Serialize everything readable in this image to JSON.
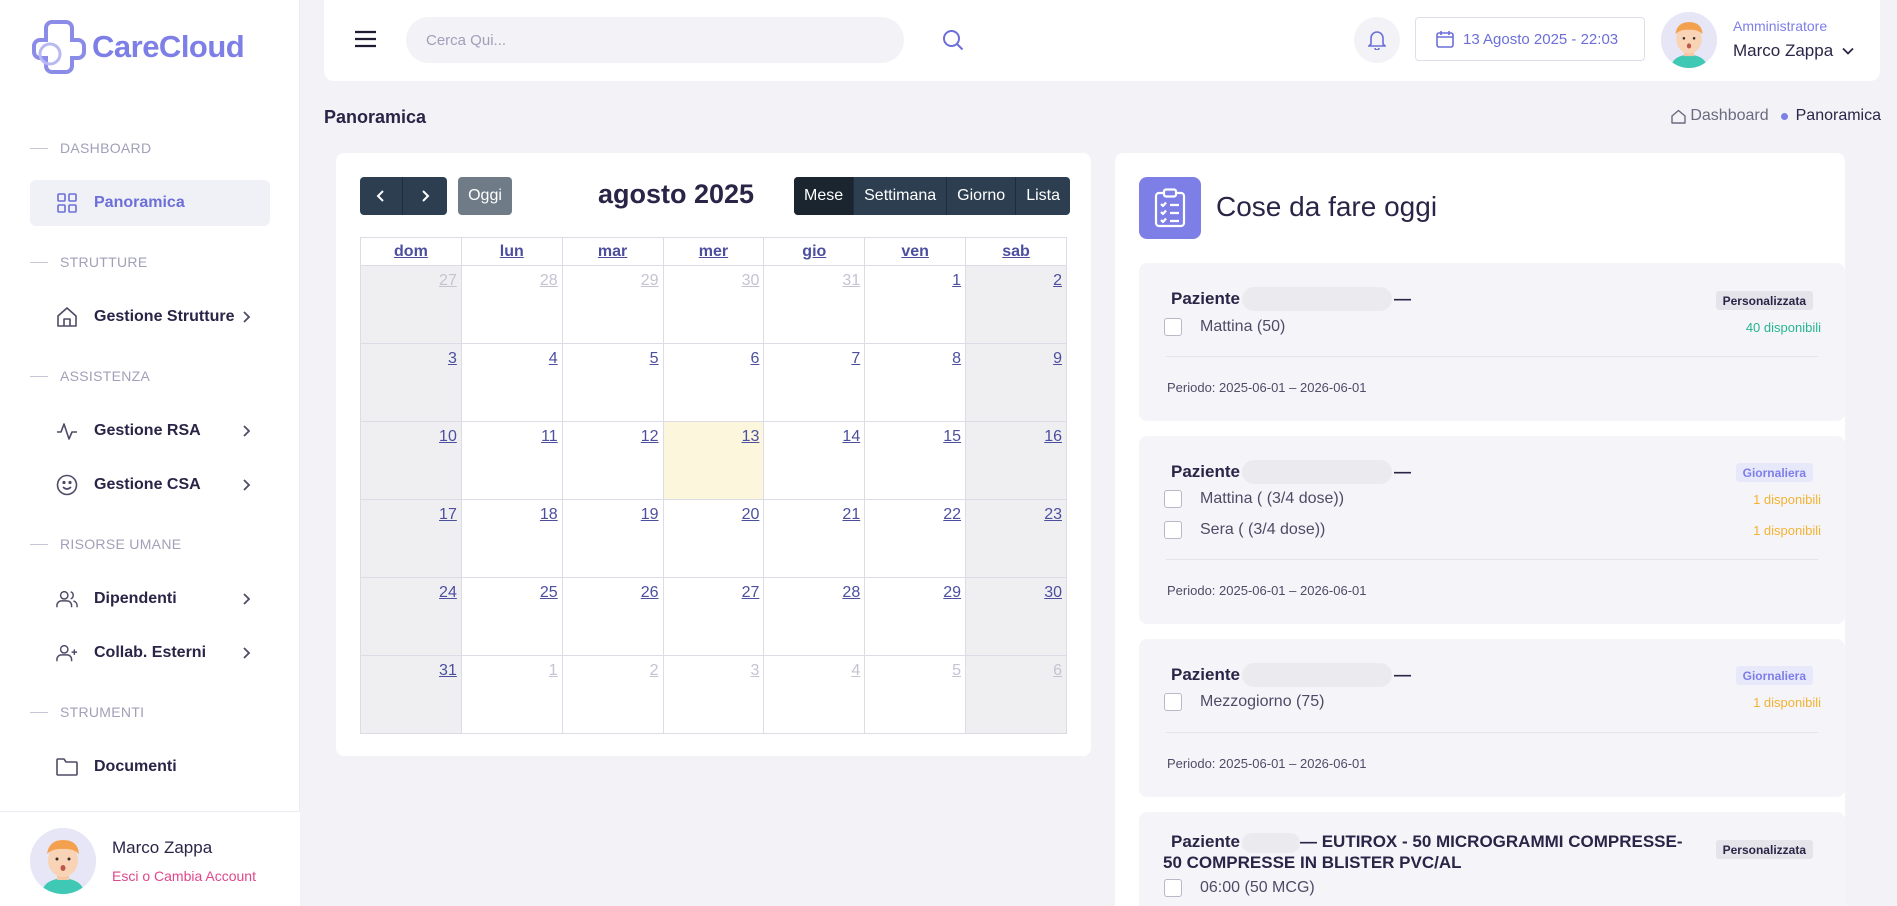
{
  "brand": {
    "name": "CareCloud",
    "color": "#7d7fe7"
  },
  "sidebar": {
    "sections": [
      {
        "label": "DASHBOARD"
      },
      {
        "label": "STRUTTURE"
      },
      {
        "label": "ASSISTENZA"
      },
      {
        "label": "RISORSE UMANE"
      },
      {
        "label": "STRUMENTI"
      }
    ],
    "items": [
      {
        "label": "Panoramica",
        "icon": "grid-icon",
        "active": true
      },
      {
        "label": "Gestione Strutture",
        "icon": "home-icon"
      },
      {
        "label": "Gestione RSA",
        "icon": "activity-icon"
      },
      {
        "label": "Gestione CSA",
        "icon": "smile-icon"
      },
      {
        "label": "Dipendenti",
        "icon": "users-icon"
      },
      {
        "label": "Collab. Esterni",
        "icon": "user-plus-icon"
      },
      {
        "label": "Documenti",
        "icon": "folder-icon"
      }
    ],
    "footer": {
      "name": "Marco Zappa",
      "action": "Esci o Cambia Account"
    }
  },
  "header": {
    "search_placeholder": "Cerca Qui...",
    "datetime": "13 Agosto 2025 - 22:03",
    "user_role": "Amministratore",
    "user_name": "Marco Zappa"
  },
  "page": {
    "title": "Panoramica",
    "breadcrumb": [
      "Dashboard",
      "Panoramica"
    ]
  },
  "calendar": {
    "today_label": "Oggi",
    "title": "agosto 2025",
    "views": [
      "Mese",
      "Settimana",
      "Giorno",
      "Lista"
    ],
    "active_view": "Mese",
    "weekdays": [
      "dom",
      "lun",
      "mar",
      "mer",
      "gio",
      "ven",
      "sab"
    ],
    "weeks": [
      [
        "27",
        "28",
        "29",
        "30",
        "31",
        "1",
        "2"
      ],
      [
        "3",
        "4",
        "5",
        "6",
        "7",
        "8",
        "9"
      ],
      [
        "10",
        "11",
        "12",
        "13",
        "14",
        "15",
        "16"
      ],
      [
        "17",
        "18",
        "19",
        "20",
        "21",
        "22",
        "23"
      ],
      [
        "24",
        "25",
        "26",
        "27",
        "28",
        "29",
        "30"
      ],
      [
        "31",
        "1",
        "2",
        "3",
        "4",
        "5",
        "6"
      ]
    ],
    "today": "13"
  },
  "todo": {
    "title": "Cose da fare oggi",
    "tasks": [
      {
        "label": "Paziente",
        "suffix": "—",
        "type": "Personalizzata",
        "doses": [
          {
            "label": "Mattina (50)",
            "available": "40 disponibili",
            "status": "ok"
          }
        ],
        "period": "Periodo: 2025-06-01 – 2026-06-01"
      },
      {
        "label": "Paziente",
        "suffix": "—",
        "type": "Giornaliera",
        "doses": [
          {
            "label": "Mattina ( (3/4 dose))",
            "available": "1 disponibili",
            "status": "warn"
          },
          {
            "label": "Sera ( (3/4 dose))",
            "available": "1 disponibili",
            "status": "warn"
          }
        ],
        "period": "Periodo: 2025-06-01 – 2026-06-01"
      },
      {
        "label": "Paziente",
        "suffix": "—",
        "type": "Giornaliera",
        "doses": [
          {
            "label": "Mezzogiorno (75)",
            "available": "1 disponibili",
            "status": "warn"
          }
        ],
        "period": "Periodo: 2025-06-01 – 2026-06-01"
      },
      {
        "label": "Paziente",
        "suffix": "— EUTIROX - 50 MICROGRAMMI COMPRESSE- 50 COMPRESSE IN BLISTER PVC/AL",
        "type": "Personalizzata",
        "doses": [
          {
            "label": "06:00 (50 MCG)"
          }
        ]
      }
    ]
  }
}
